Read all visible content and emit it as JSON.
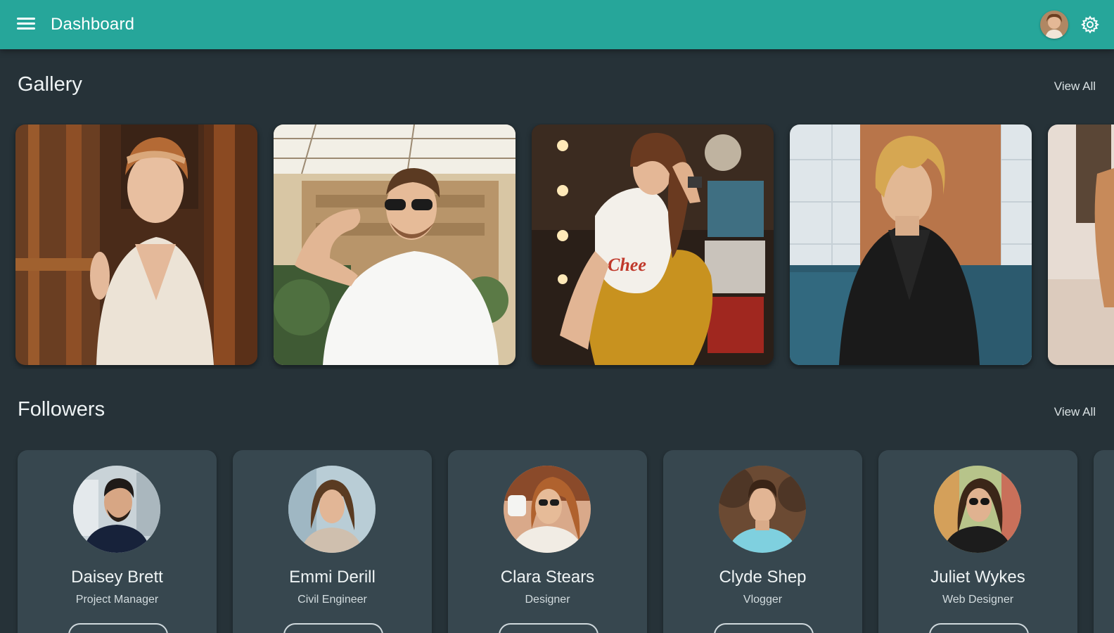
{
  "appbar": {
    "title": "Dashboard",
    "menu_icon": "hamburger-menu-icon",
    "avatar_icon": "user-avatar",
    "settings_icon": "gear-icon",
    "background": "#26a69a"
  },
  "gallery": {
    "title": "Gallery",
    "view_all": "View All",
    "photos": [
      {
        "shirt_text": ""
      },
      {
        "shirt_text": ""
      },
      {
        "shirt_text": "Chee"
      },
      {
        "shirt_text": ""
      },
      {
        "shirt_text": ""
      }
    ]
  },
  "followers": {
    "title": "Followers",
    "view_all": "View All",
    "items": [
      {
        "name": "Daisey Brett",
        "role": "Project Manager"
      },
      {
        "name": "Emmi Derill",
        "role": "Civil Engineer"
      },
      {
        "name": "Clara Stears",
        "role": "Designer"
      },
      {
        "name": "Clyde Shep",
        "role": "Vlogger"
      },
      {
        "name": "Juliet Wykes",
        "role": "Web Designer"
      }
    ]
  },
  "colors": {
    "page_background": "#263238",
    "card_background": "#37474f",
    "accent": "#26a69a"
  }
}
